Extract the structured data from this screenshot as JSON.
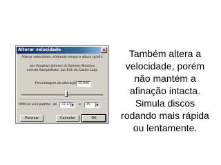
{
  "dialog": {
    "title": "Alterar velocidade",
    "description": "Alterar velocidade, afetando tempo e altura (pitch)",
    "credits_line1": "por Vaughan Johnson & Dominic Mazzoni",
    "credits_line2": "usando SampleRate, por Erik de Castro Lopo",
    "percent_label": "Percentagem de alteração:",
    "percent_value": "35,000",
    "slider_level": 0.55,
    "rpm_label": "RPM do vinil padrão:",
    "rpm_from_label": "de",
    "rpm_from_value": "33 1/3",
    "rpm_to_label": "a",
    "rpm_to_value": "45",
    "preview_button": "Preview",
    "cancel_button": "Cancelar",
    "ok_button": "OK"
  },
  "caption": {
    "lines": [
      "Também altera a",
      "velocidade, porém",
      "não mantém a",
      "afinação intacta.",
      "Simula discos",
      "rodando mais rápida",
      "ou lentamente."
    ]
  }
}
